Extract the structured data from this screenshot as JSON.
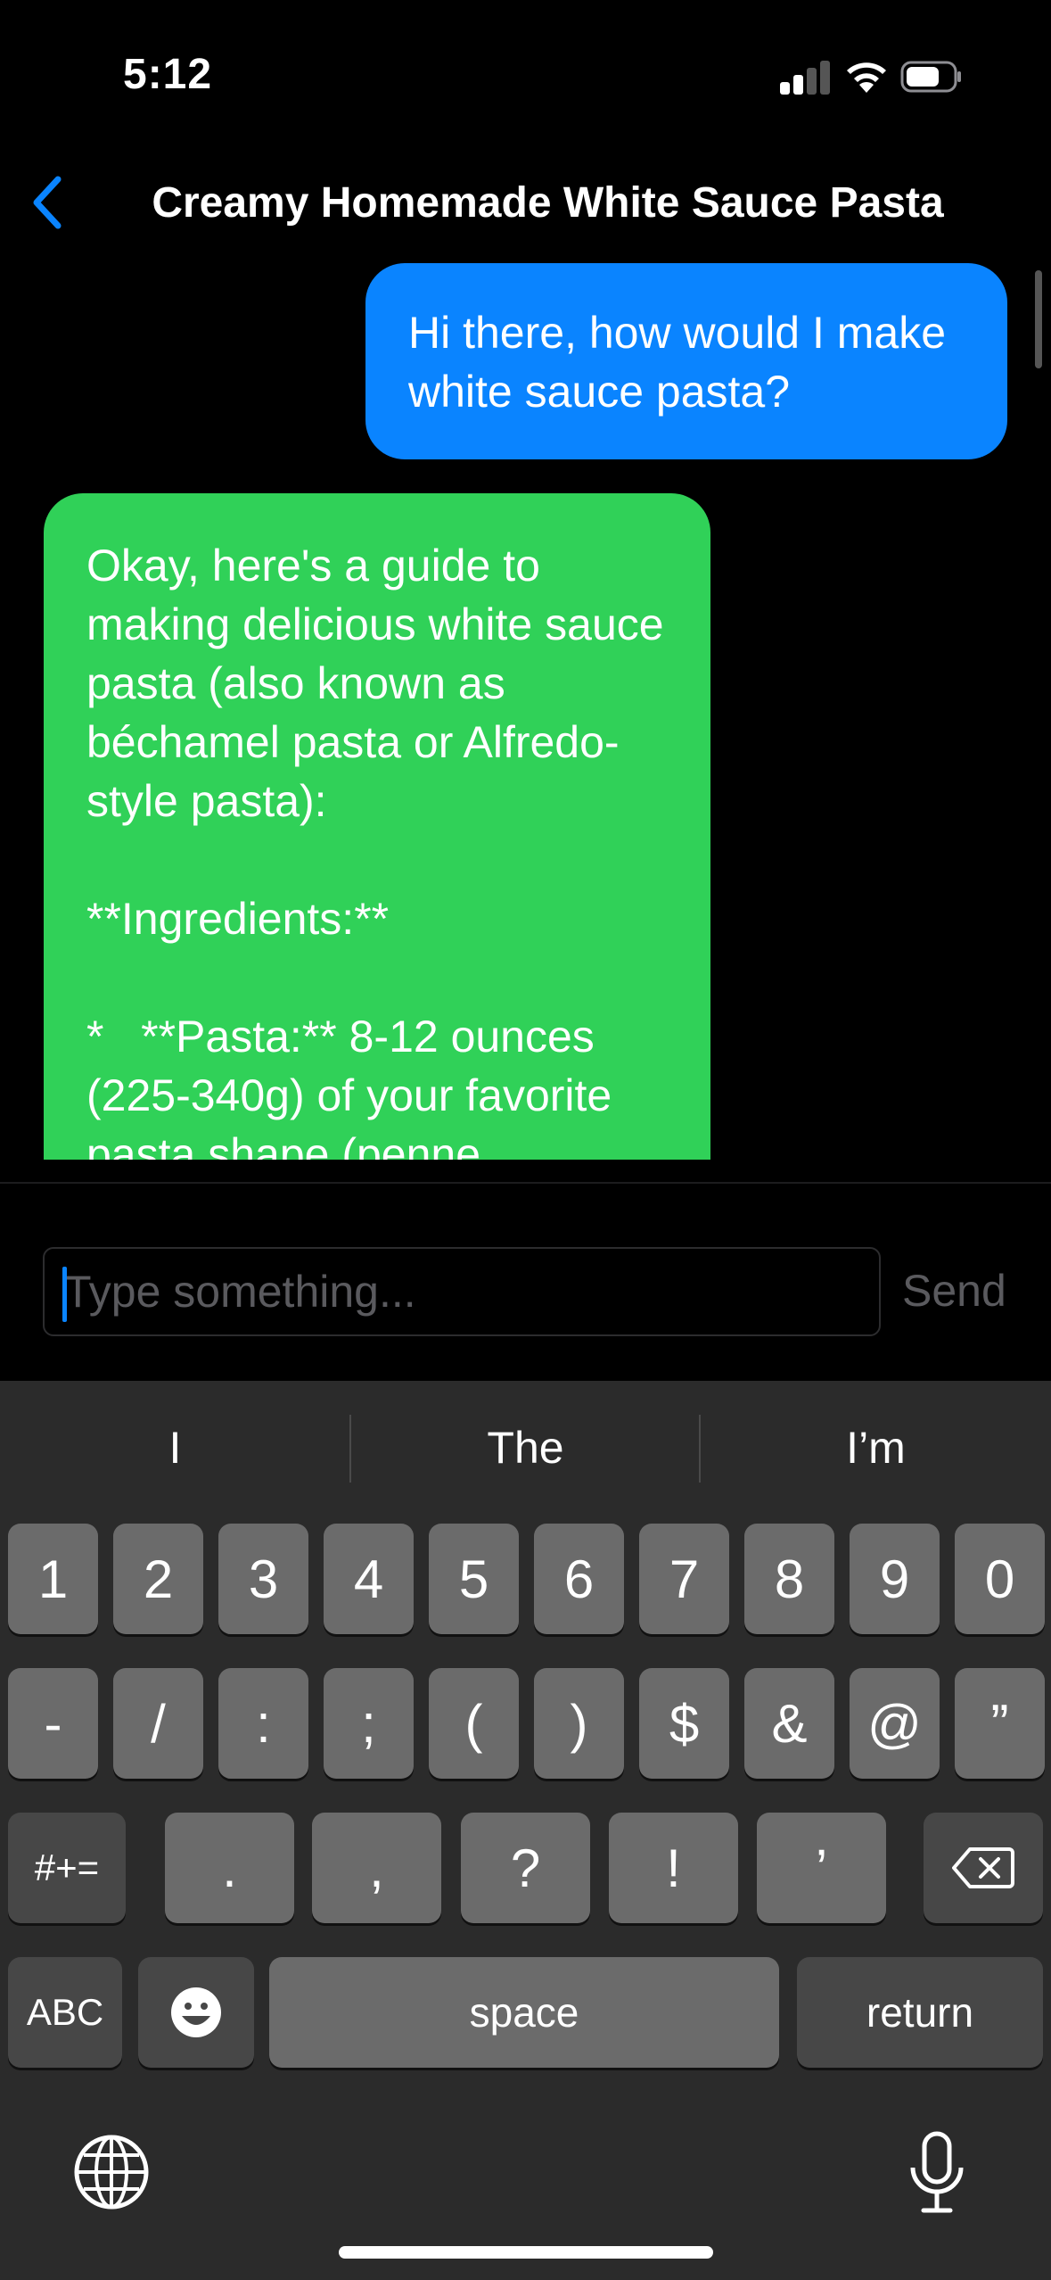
{
  "status_bar": {
    "time": "5:12"
  },
  "nav": {
    "title": "Creamy Homemade White Sauce Pasta"
  },
  "messages": [
    {
      "role": "user",
      "text": "Hi there, how would I make white sauce pasta?"
    },
    {
      "role": "assistant",
      "text": "Okay, here's a guide to making delicious white sauce pasta (also known as béchamel pasta or Alfredo-style pasta):\n\n**Ingredients:**\n\n*   **Pasta:** 8-12 ounces (225-340g) of your favorite pasta shape (penne,"
    }
  ],
  "composer": {
    "placeholder": "Type something...",
    "value": "",
    "send_label": "Send"
  },
  "keyboard": {
    "suggestions": [
      "I",
      "The",
      "I’m"
    ],
    "row1": [
      "1",
      "2",
      "3",
      "4",
      "5",
      "6",
      "7",
      "8",
      "9",
      "0"
    ],
    "row2": [
      "-",
      "/",
      ":",
      ";",
      "(",
      ")",
      "$",
      "&",
      "@",
      "”"
    ],
    "row3": [
      "#+=",
      ".",
      ",",
      "?",
      "!",
      "’"
    ],
    "row4": {
      "abc": "ABC",
      "space": "space",
      "return": "return"
    }
  },
  "colors": {
    "user_bubble": "#0a84ff",
    "assistant_bubble": "#30d158",
    "accent": "#0a84ff"
  }
}
